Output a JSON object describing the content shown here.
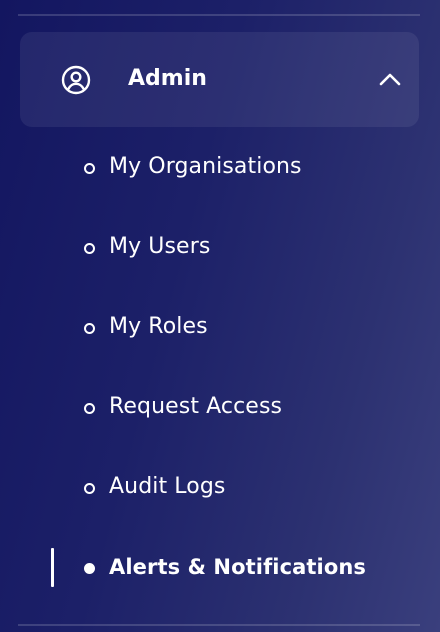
{
  "menu": {
    "section": {
      "label": "Admin",
      "icon": "user-circle-icon",
      "expanded": true,
      "toggle_icon": "chevron-up-icon"
    },
    "items": [
      {
        "label": "My Organisations",
        "active": false
      },
      {
        "label": "My Users",
        "active": false
      },
      {
        "label": "My Roles",
        "active": false
      },
      {
        "label": "Request Access",
        "active": false
      },
      {
        "label": "Audit Logs",
        "active": false
      },
      {
        "label": "Alerts & Notifications",
        "active": true
      }
    ]
  },
  "colors": {
    "background_start": "#131660",
    "background_end": "#3a3f7d",
    "text": "#ffffff"
  }
}
